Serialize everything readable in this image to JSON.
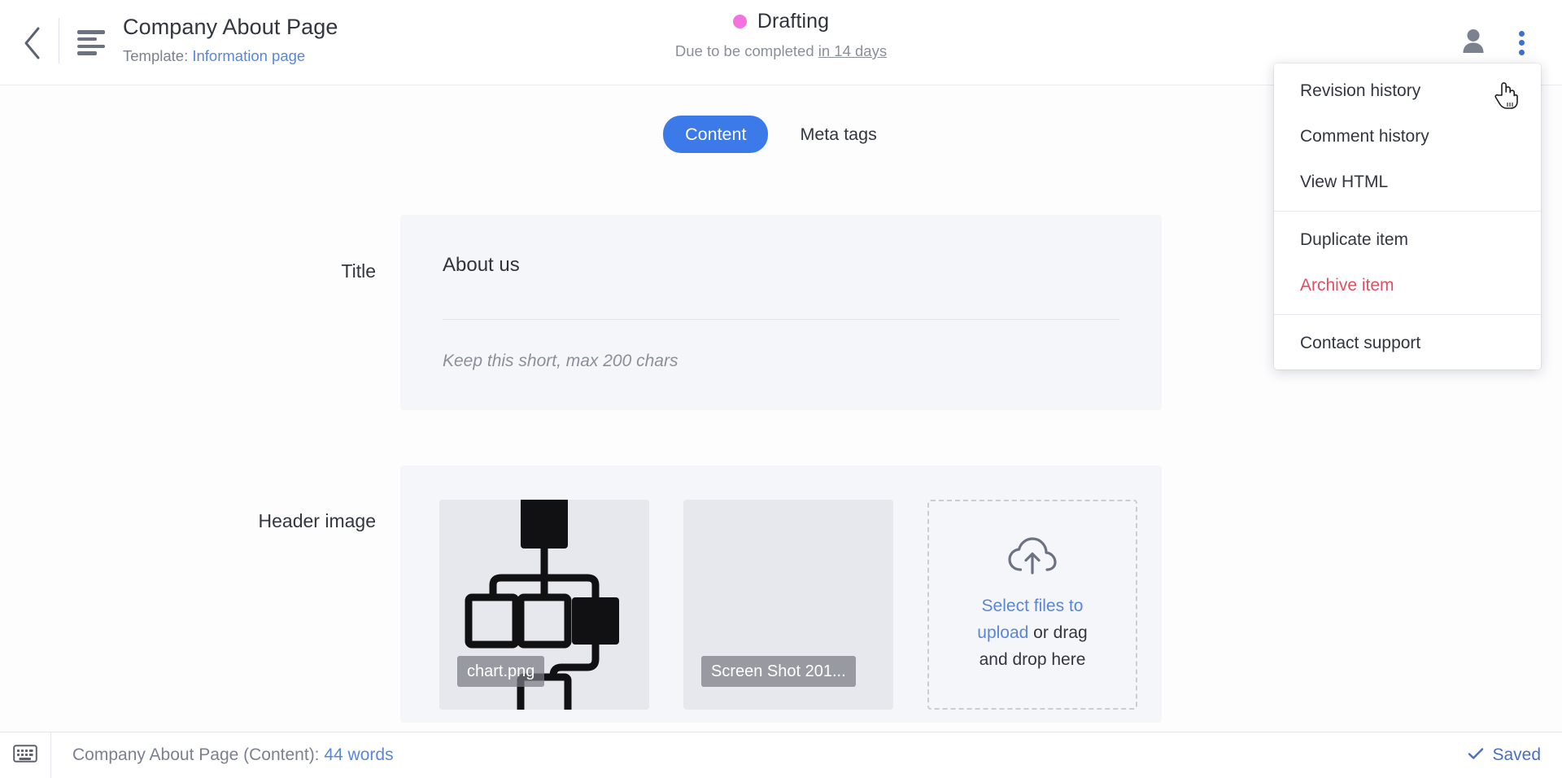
{
  "header": {
    "back_icon": "chevron-left-icon",
    "doc_icon": "document-lines-icon",
    "title": "Company About Page",
    "template_prefix": "Template:",
    "template_name": "Information page",
    "status_label": "Drafting",
    "status_color": "#f472e0",
    "due_prefix": "Due to be completed",
    "due_value": "in 14 days",
    "user_icon": "person-icon",
    "menu_icon": "kebab-menu-icon"
  },
  "dropdown": {
    "groups": [
      {
        "items": [
          {
            "label": "Revision history",
            "danger": false
          },
          {
            "label": "Comment history",
            "danger": false
          },
          {
            "label": "View HTML",
            "danger": false
          }
        ]
      },
      {
        "items": [
          {
            "label": "Duplicate item",
            "danger": false
          },
          {
            "label": "Archive item",
            "danger": true
          }
        ]
      },
      {
        "items": [
          {
            "label": "Contact support",
            "danger": false
          }
        ]
      }
    ],
    "danger_color": "#e05062"
  },
  "tabs": [
    {
      "label": "Content",
      "active": true
    },
    {
      "label": "Meta tags",
      "active": false
    }
  ],
  "fields": {
    "title": {
      "label": "Title",
      "value": "About us",
      "hint": "Keep this short, max 200 chars"
    },
    "header_image": {
      "label": "Header image",
      "thumbnails": [
        {
          "filename": "chart.png",
          "kind": "diagram-thumbnail"
        },
        {
          "filename": "Screen Shot 201...",
          "kind": "blank-thumbnail"
        }
      ],
      "dropzone": {
        "icon": "cloud-upload-icon",
        "link_text": "Select files to upload",
        "rest_text": " or drag and drop here"
      }
    }
  },
  "statusbar": {
    "keyboard_icon": "keyboard-icon",
    "info_prefix": "Company About Page (Content):",
    "word_count": "44 words",
    "saved_icon": "check-icon",
    "saved_label": "Saved",
    "accent_color": "#5a86d8"
  }
}
